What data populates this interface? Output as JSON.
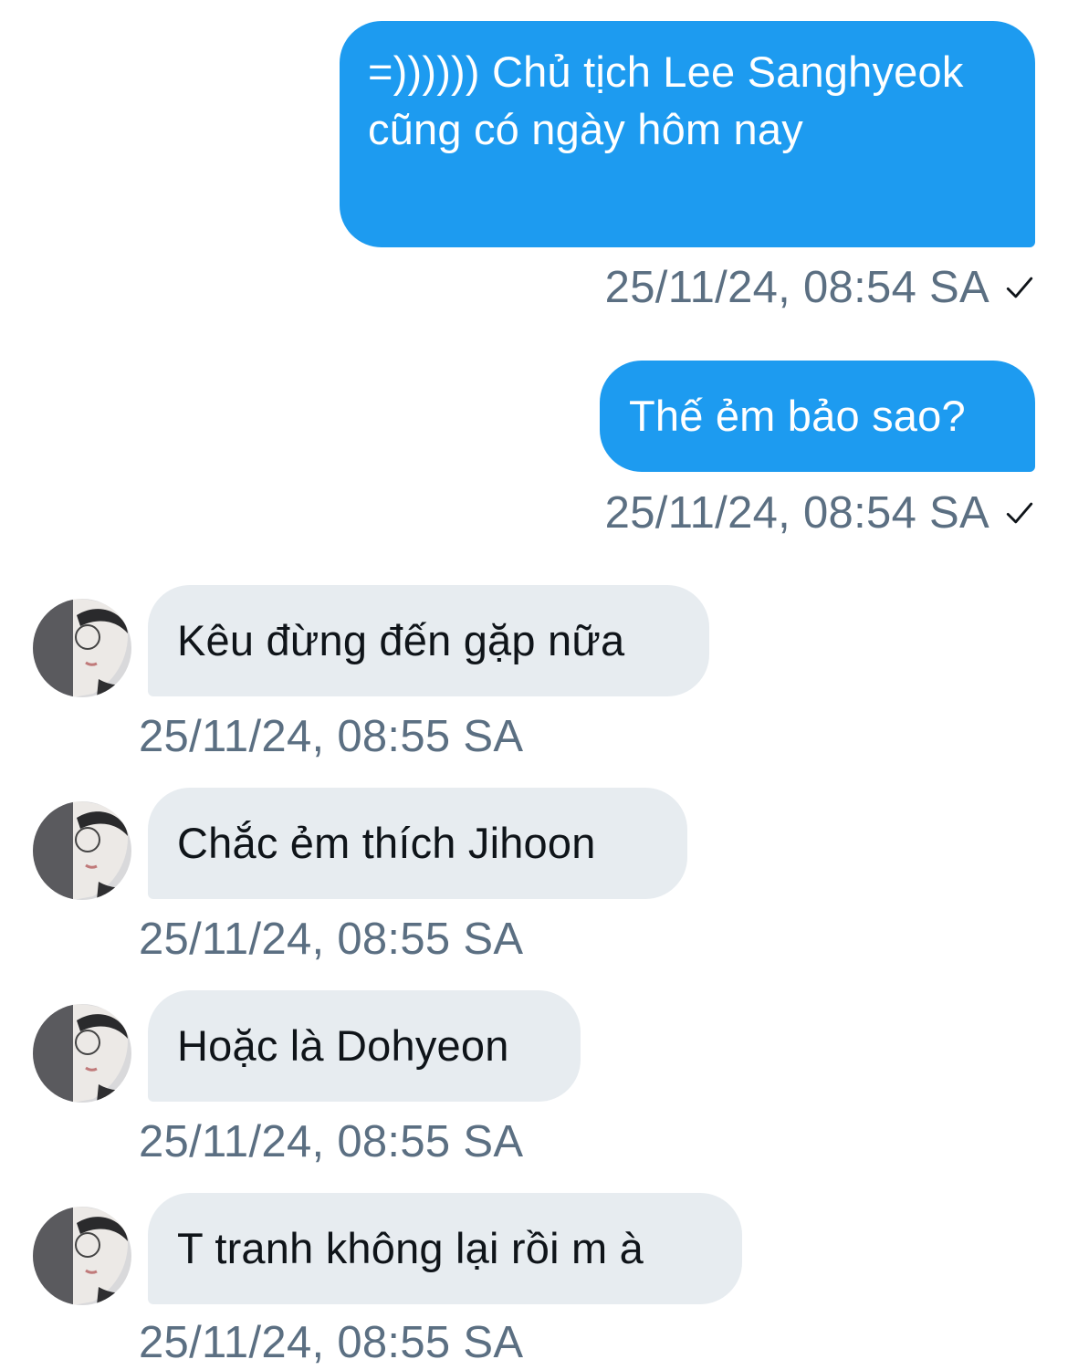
{
  "messages": [
    {
      "direction": "out",
      "text": "=)))))) Chủ tịch Lee Sanghyeok cũng có ngày hôm nay",
      "time": "25/11/24, 08:54 SA",
      "status_icon": "checkmark-icon"
    },
    {
      "direction": "out",
      "text": "Thế ẻm bảo sao?",
      "time": "25/11/24, 08:54 SA",
      "status_icon": "checkmark-icon"
    },
    {
      "direction": "in",
      "text": "Kêu đừng đến gặp nữa",
      "time": "25/11/24, 08:55 SA"
    },
    {
      "direction": "in",
      "text": "Chắc ẻm thích Jihoon",
      "time": "25/11/24, 08:55 SA"
    },
    {
      "direction": "in",
      "text": "Hoặc là Dohyeon",
      "time": "25/11/24, 08:55 SA"
    },
    {
      "direction": "in",
      "text": "T tranh không lại rồi m à",
      "time": "25/11/24, 08:55 SA"
    }
  ],
  "colors": {
    "outgoing_bubble": "#1d9bf0",
    "incoming_bubble": "#e7ecf0",
    "timestamp": "#5b6f82",
    "background": "#ffffff"
  }
}
